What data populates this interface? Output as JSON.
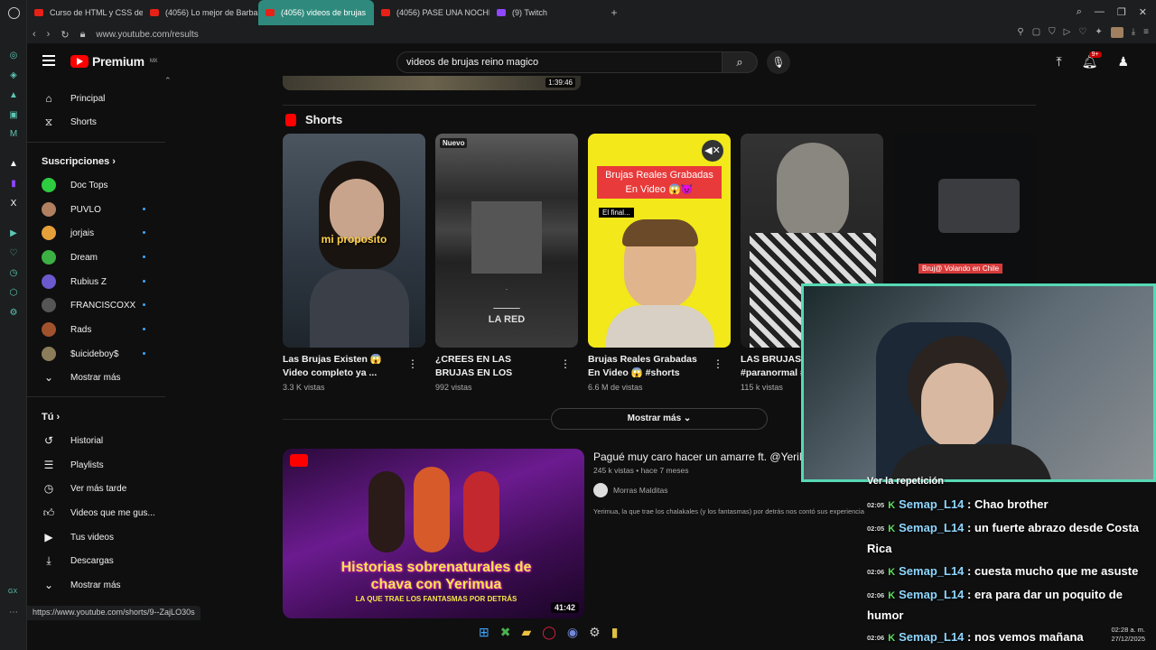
{
  "browser": {
    "tabs": [
      {
        "title": "Curso de HTML y CSS de"
      },
      {
        "title": "(4056) Lo mejor de Barba"
      },
      {
        "title": "(4056) videos de brujas"
      },
      {
        "title": "(4056) PASE UNA NOCHE"
      },
      {
        "title": "(9) Twitch"
      }
    ],
    "url": "www.youtube.com/results",
    "status_url": "https://www.youtube.com/shorts/9--ZajLO30s"
  },
  "youtube": {
    "logo_text": "Premium",
    "logo_region": "MX",
    "search_query": "videos de brujas reino magico",
    "notif_count": "9+"
  },
  "sidebar": {
    "items": [
      {
        "label": "Principal",
        "icon": "home-icon"
      },
      {
        "label": "Shorts",
        "icon": "shorts-icon"
      }
    ],
    "subs_heading": "Suscripciones",
    "subs": [
      {
        "label": "Doc Tops",
        "color": "#2ecc40"
      },
      {
        "label": "PUVLO",
        "color": "#b08060"
      },
      {
        "label": "jorjais",
        "color": "#e6a03a"
      },
      {
        "label": "Dream",
        "color": "#3cb043"
      },
      {
        "label": "Rubius Z",
        "color": "#6a5acd"
      },
      {
        "label": "FRANCISCOXX",
        "color": "#555555"
      },
      {
        "label": "Rads",
        "color": "#a0522d"
      },
      {
        "label": "$uicideboy$",
        "color": "#8b7d5a"
      }
    ],
    "subs_more": "Mostrar más",
    "you_heading": "Tú",
    "you_items": [
      {
        "label": "Historial"
      },
      {
        "label": "Playlists"
      },
      {
        "label": "Ver más tarde"
      },
      {
        "label": "Videos que me gus..."
      },
      {
        "label": "Tus videos"
      },
      {
        "label": "Descargas"
      }
    ],
    "you_more": "Mostrar más"
  },
  "top_thumb": {
    "duration": "1:39:46"
  },
  "shorts": {
    "heading": "Shorts",
    "cards": [
      {
        "title": "Las Brujas Existen 😱 Video completo ya ...",
        "views": "3.3 K vistas",
        "overlay": "mi proposito",
        "badge": ""
      },
      {
        "title": "¿CREES EN LAS BRUJAS EN LOS BOSQUES ...",
        "views": "992 vistas",
        "overlay": "LA RED",
        "badge": "Nuevo"
      },
      {
        "title": "Brujas Reales Grabadas En Video 😱 #shorts",
        "views": "6.6 M de vistas",
        "overlay": "Brujas Reales Grabadas En Video 😱😈",
        "badge": "El final..."
      },
      {
        "title": "LAS BRUJAS #... #paranormal #...",
        "views": "115 k vistas",
        "overlay": "",
        "badge": ""
      },
      {
        "title": "",
        "views": "",
        "overlay": "Bruj@ Volando en Chile",
        "badge": ""
      }
    ],
    "more_button": "Mostrar más"
  },
  "video": {
    "title": "Pagué muy caro hacer un amarre ft. @YeriMua",
    "meta": "245 k vistas • hace 7 meses",
    "channel": "Morras Malditas",
    "description": "Yerimua, la que trae los chalakales (y los fantasmas) por detrás nos contó sus experiencias sobrenaturales pero especialmente...",
    "duration": "41:42",
    "thumb_headline": "Historias sobrenaturales de chava con Yerimua",
    "thumb_sub": "LA QUE TRAE LOS FANTASMAS POR DETRÁS"
  },
  "chat": {
    "header": "Ver la repetición",
    "messages": [
      {
        "time": "02:05",
        "user": "Semap_L14",
        "text": "Chao brother"
      },
      {
        "time": "02:05",
        "user": "Semap_L14",
        "text": "un fuerte abrazo desde Costa Rica"
      },
      {
        "time": "02:06",
        "user": "Semap_L14",
        "text": "cuesta mucho que me asuste"
      },
      {
        "time": "02:06",
        "user": "Semap_L14",
        "text": "era para dar un poquito de humor"
      },
      {
        "time": "02:06",
        "user": "Semap_L14",
        "text": "nos vemos mañana"
      }
    ]
  },
  "system": {
    "time": "02:28 a. m.",
    "date": "27/12/2025"
  },
  "colors": {
    "accent": "#2f8a7d",
    "brand": "#ff0000",
    "cam_border": "#57d9b5"
  }
}
